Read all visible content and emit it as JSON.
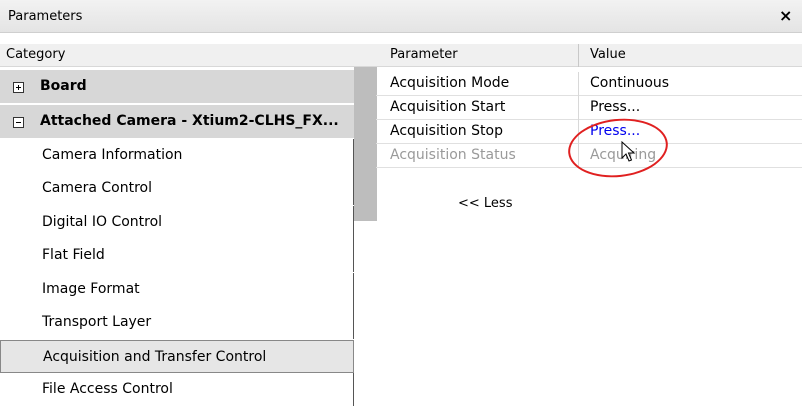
{
  "window": {
    "title": "Parameters",
    "close_glyph": "×"
  },
  "categories": {
    "header": "Category",
    "groups": [
      {
        "label": "Board",
        "expanded": false
      },
      {
        "label": "Attached Camera - Xtium2-CLHS_FX...",
        "expanded": true
      }
    ],
    "items": [
      {
        "label": "Camera Information"
      },
      {
        "label": "Camera Control"
      },
      {
        "label": "Digital IO Control"
      },
      {
        "label": "Flat Field"
      },
      {
        "label": "Image Format"
      },
      {
        "label": "Transport Layer"
      },
      {
        "label": "Acquisition and Transfer Control",
        "selected": true
      },
      {
        "label": "File Access Control"
      }
    ]
  },
  "parameters": {
    "columns": {
      "parameter": "Parameter",
      "value": "Value"
    },
    "rows": [
      {
        "name": "Acquisition Mode",
        "value": "Continuous",
        "state": "normal"
      },
      {
        "name": "Acquisition Start",
        "value": "Press...",
        "state": "normal"
      },
      {
        "name": "Acquisition Stop",
        "value": "Press...",
        "state": "link"
      },
      {
        "name": "Acquisition Status",
        "value": "Acquiring",
        "state": "disabled"
      }
    ],
    "less_label": "<< Less"
  },
  "annotation": {
    "highlight_color": "#e02020",
    "icon": "mouse-pointer-icon"
  }
}
